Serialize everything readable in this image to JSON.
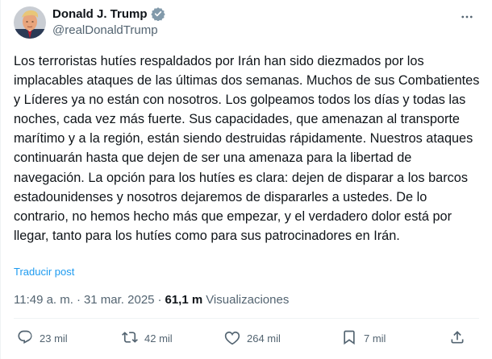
{
  "post": {
    "author": {
      "display_name": "Donald J. Trump",
      "handle": "@realDonaldTrump",
      "verified_icon": "verified-badge-icon",
      "verified_color": "#829aab"
    },
    "text": "Los terroristas hutíes respaldados por Irán han sido diezmados por los implacables ataques de las últimas dos semanas. Muchos de sus Combatientes y Líderes ya no están con nosotros. Los golpeamos todos los días y todas las noches, cada vez más fuerte. Sus capacidades, que amenazan al transporte marítimo y a la región, están siendo destruidas rápidamente. Nuestros ataques continuarán hasta que dejen de ser una amenaza para la libertad de navegación. La opción para los hutíes es clara: dejen de disparar a los barcos estadounidenses y nosotros dejaremos de dispararles a ustedes. De lo contrario, no hemos hecho más que empezar, y el verdadero dolor está por llegar, tanto para los hutíes como para sus patrocinadores en Irán.",
    "translate_label": "Traducir post",
    "time": "11:49 a. m.",
    "separator": "·",
    "date": "31 mar. 2025",
    "views_count": "61,1 m",
    "views_label": "Visualizaciones"
  },
  "actions": {
    "reply_count": "23 mil",
    "repost_count": "42 mil",
    "like_count": "264 mil",
    "bookmark_count": "7 mil"
  },
  "colors": {
    "text_primary": "#0f1419",
    "text_secondary": "#536471",
    "link": "#1d9bf0",
    "divider": "#eff3f4"
  }
}
